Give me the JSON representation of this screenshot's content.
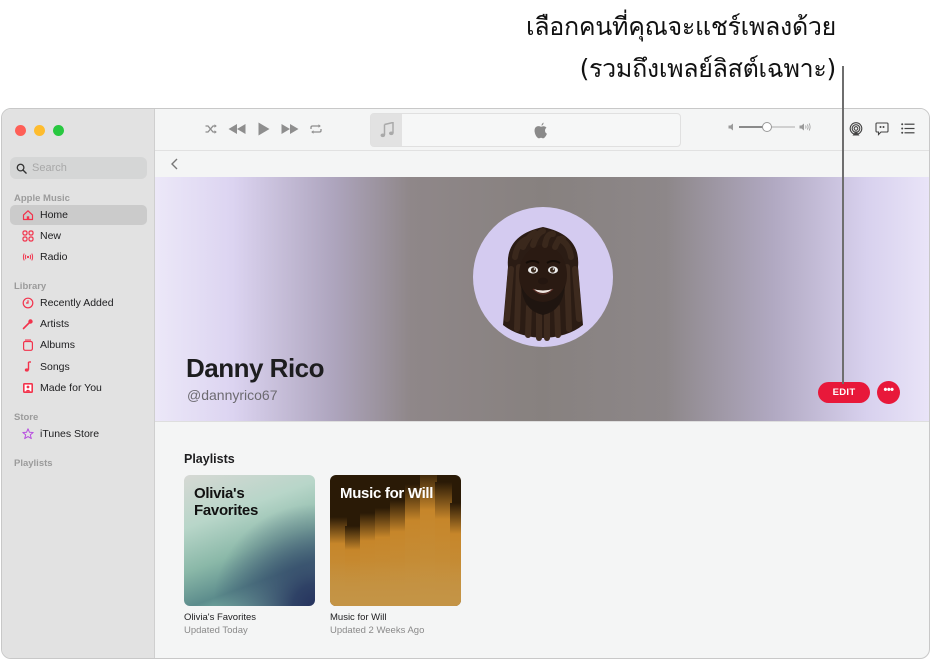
{
  "callout": {
    "line1": "เลือกคนที่คุณจะแชร์เพลงด้วย",
    "line2": "(รวมถึงเพลย์ลิสต์เฉพาะ)"
  },
  "sidebar": {
    "search_placeholder": "Search",
    "sections": {
      "apple_music": "Apple Music",
      "library": "Library",
      "store": "Store",
      "playlists": "Playlists"
    },
    "apple_music_items": [
      {
        "label": "Home",
        "icon": "house-icon",
        "active": true
      },
      {
        "label": "New",
        "icon": "grid-icon",
        "active": false
      },
      {
        "label": "Radio",
        "icon": "radio-waves-icon",
        "active": false
      }
    ],
    "library_items": [
      {
        "label": "Recently Added",
        "icon": "clock-icon"
      },
      {
        "label": "Artists",
        "icon": "microphone-icon"
      },
      {
        "label": "Albums",
        "icon": "album-icon"
      },
      {
        "label": "Songs",
        "icon": "music-note-icon"
      },
      {
        "label": "Made for You",
        "icon": "person-square-icon"
      }
    ],
    "store_items": [
      {
        "label": "iTunes Store",
        "icon": "star-icon"
      }
    ]
  },
  "toolbar": {
    "controls": [
      "shuffle-icon",
      "rewind-icon",
      "play-icon",
      "fast-forward-icon",
      "repeat-icon"
    ],
    "volume_level": 0.5,
    "right_icons": [
      "airplay-icon",
      "lyrics-icon",
      "queue-list-icon"
    ]
  },
  "profile": {
    "name": "Danny Rico",
    "handle": "@dannyrico67",
    "edit_label": "EDIT",
    "more_label": "•••"
  },
  "playlists": {
    "heading": "Playlists",
    "items": [
      {
        "art_title": "Olivia's Favorites",
        "title": "Olivia's Favorites",
        "subtitle": "Updated Today"
      },
      {
        "art_title": "Music for Will",
        "title": "Music for Will",
        "subtitle": "Updated 2 Weeks Ago"
      }
    ]
  },
  "colors": {
    "accent": "#e8183a",
    "sidebar_icon": "#f2334c",
    "store_icon": "#b74de0"
  }
}
